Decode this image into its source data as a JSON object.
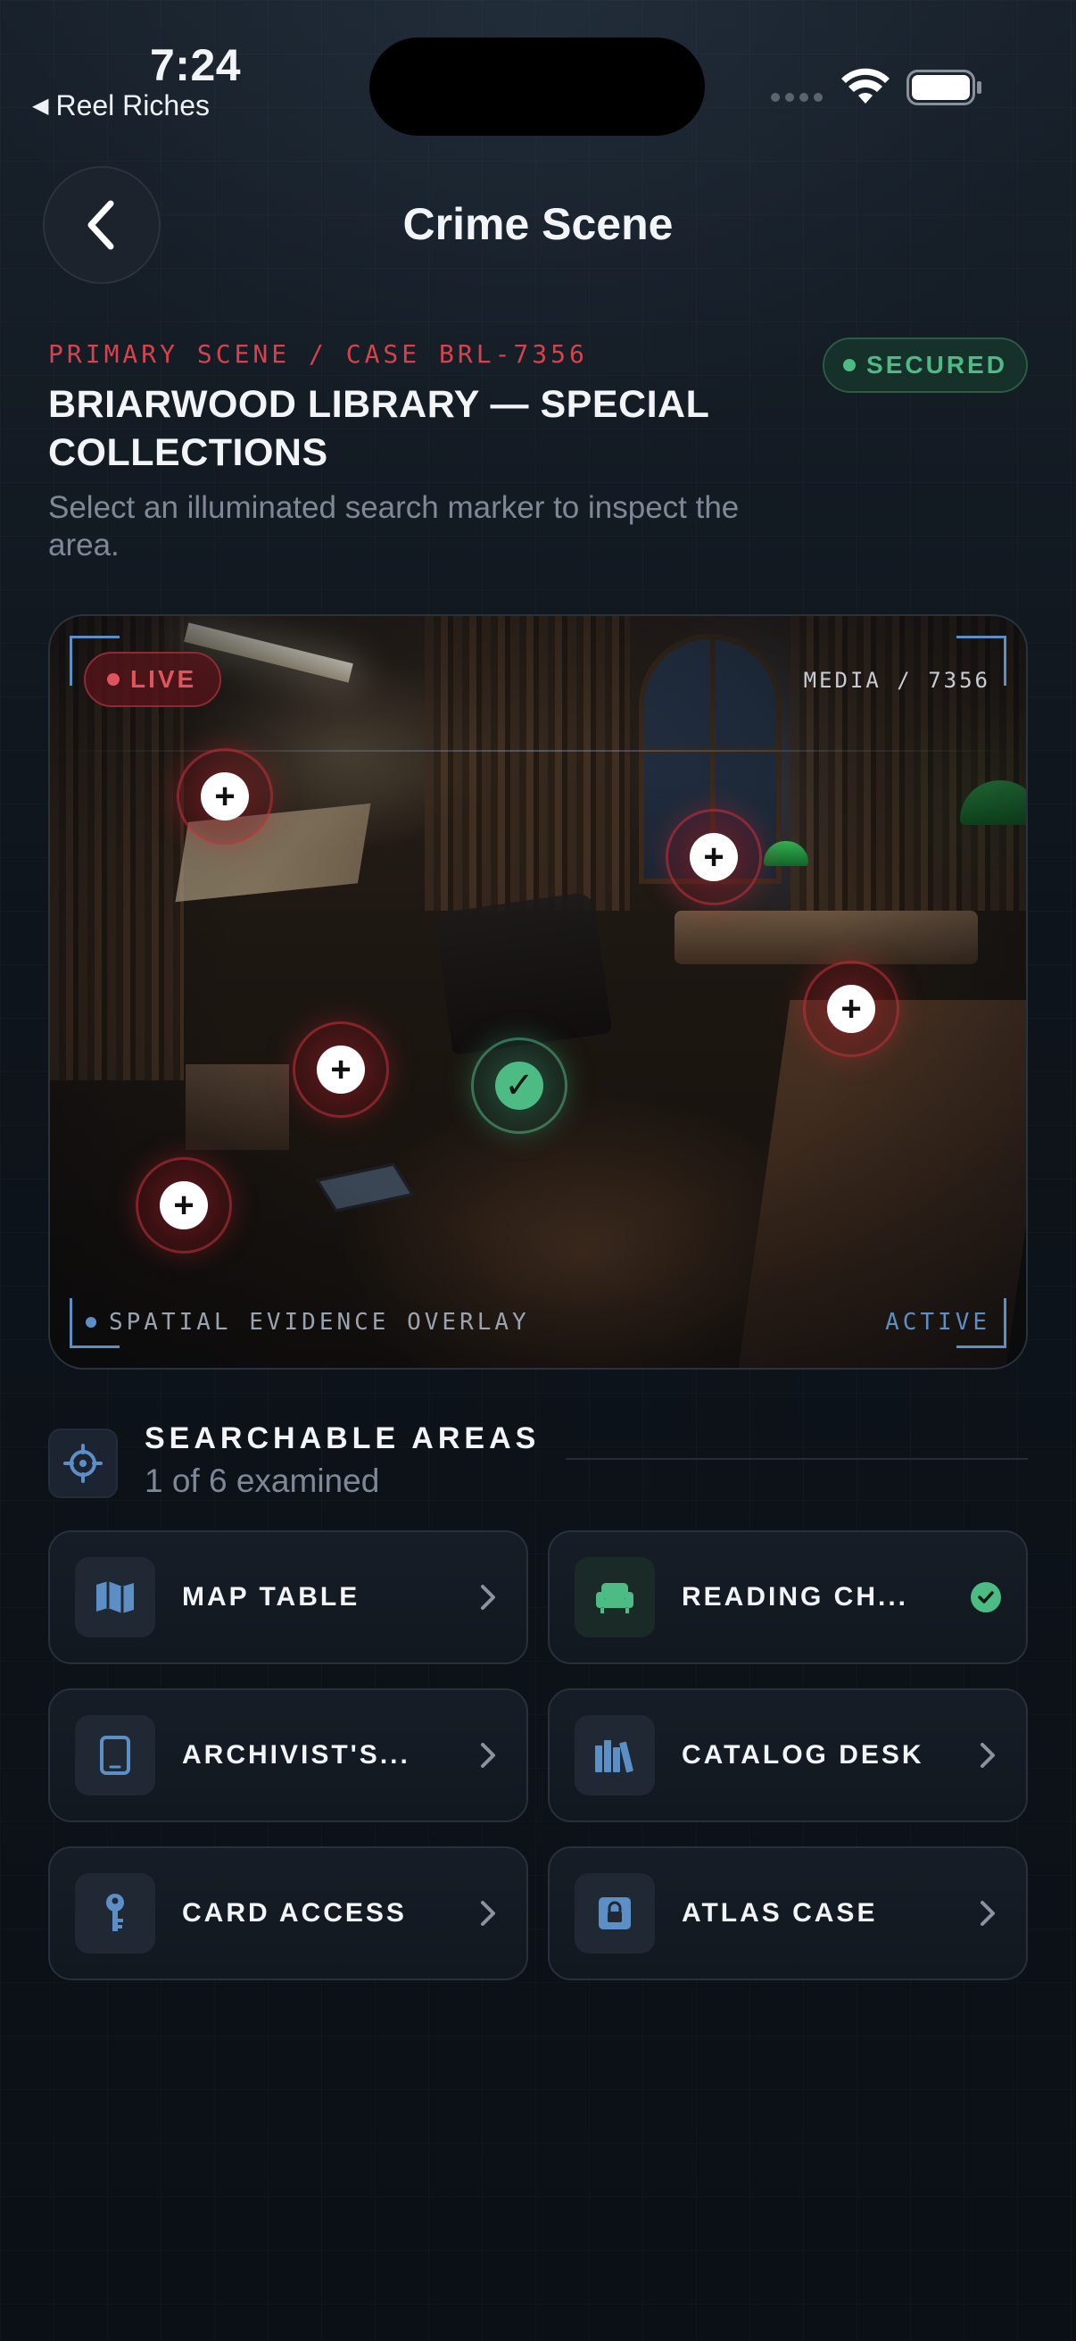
{
  "status_bar": {
    "time": "7:24",
    "back_app": "Reel Riches"
  },
  "nav": {
    "title": "Crime Scene"
  },
  "header": {
    "case_line": "PRIMARY SCENE / CASE BRL-7356",
    "status_badge": "SECURED",
    "location_title": "BRIARWOOD LIBRARY — SPECIAL COLLECTIONS",
    "hint": "Select an illuminated search marker to inspect the area."
  },
  "scene": {
    "live_label": "LIVE",
    "media_id": "MEDIA / 7356",
    "overlay_label": "SPATIAL EVIDENCE OVERLAY",
    "overlay_state": "ACTIVE",
    "markers": [
      {
        "state": "unexamined",
        "glyph": "+"
      },
      {
        "state": "unexamined",
        "glyph": "+"
      },
      {
        "state": "unexamined",
        "glyph": "+"
      },
      {
        "state": "unexamined",
        "glyph": "+"
      },
      {
        "state": "examined",
        "glyph": "✓"
      },
      {
        "state": "unexamined",
        "glyph": "+"
      }
    ]
  },
  "areas": {
    "title": "SEARCHABLE AREAS",
    "count": "1 of 6 examined",
    "items": [
      {
        "label": "MAP TABLE",
        "icon": "map-icon",
        "examined": false
      },
      {
        "label": "READING CH...",
        "icon": "armchair-icon",
        "examined": true
      },
      {
        "label": "ARCHIVIST'S...",
        "icon": "tablet-icon",
        "examined": false
      },
      {
        "label": "CATALOG DESK",
        "icon": "books-icon",
        "examined": false
      },
      {
        "label": "CARD ACCESS",
        "icon": "key-icon",
        "examined": false
      },
      {
        "label": "ATLAS CASE",
        "icon": "lock-icon",
        "examined": false
      }
    ]
  },
  "colors": {
    "accent_red": "#d6434d",
    "accent_green": "#4dbb84",
    "accent_blue": "#5b8fc6",
    "background": "#0e141c"
  }
}
